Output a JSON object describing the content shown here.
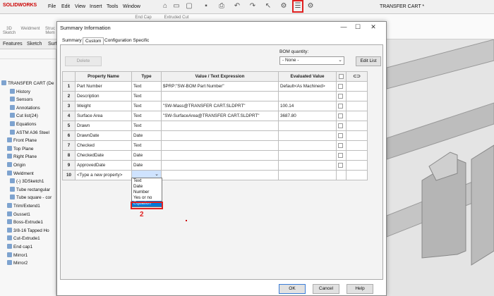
{
  "app": {
    "logo": "SOLIDWORKS",
    "menus": [
      "File",
      "Edit",
      "View",
      "Insert",
      "Tools",
      "Window"
    ],
    "window_title": "TRANSFER CART *"
  },
  "annotations": {
    "marker_1": "1",
    "marker_2": "2"
  },
  "cmdbar": {
    "items": [
      "3D Sketch",
      "Weldment",
      "Struc Mem",
      "End Cap",
      "Extruded Cut"
    ]
  },
  "left_tabs": [
    "Features",
    "Sketch",
    "Surf"
  ],
  "tree": {
    "items": [
      "TRANSFER CART (De",
      "History",
      "Sensors",
      "Annotations",
      "Cut list(24)",
      "Equations",
      "ASTM A36 Steel",
      "Front Plane",
      "Top Plane",
      "Right Plane",
      "Origin",
      "Weldment",
      "(-) 3DSketch1",
      "Tube rectangular",
      "Tube square - cor",
      "Trim/Extend1",
      "Gusset1",
      "Boss-Extrude1",
      "3/8-16 Tapped Ho",
      "Cut-Extrude1",
      "End cap1",
      "Mirror1",
      "Mirror2"
    ]
  },
  "dialog": {
    "title": "Summary Information",
    "tabs": [
      "Summary",
      "Custom",
      "Configuration Specific"
    ],
    "delete_label": "Delete",
    "bom_label": "BOM quantity:",
    "bom_value": "- None -",
    "edit_list_label": "Edit List",
    "ok_label": "OK",
    "cancel_label": "Cancel",
    "help_label": "Help",
    "columns": [
      "Property Name",
      "Type",
      "Value / Text Expression",
      "Evaluated Value"
    ],
    "rows": [
      {
        "num": "1",
        "name": "Part Number",
        "type": "Text",
        "value": "$PRP:\"SW-BOM Part Number\"",
        "evaluated": "Default<As Machined>"
      },
      {
        "num": "2",
        "name": "Description",
        "type": "Text",
        "value": "",
        "evaluated": ""
      },
      {
        "num": "3",
        "name": "Weight",
        "type": "Text",
        "value": "\"SW-Mass@TRANSFER CART.SLDPRT\"",
        "evaluated": "100.14"
      },
      {
        "num": "4",
        "name": "Surface Area",
        "type": "Text",
        "value": "\"SW-SurfaceArea@TRANSFER CART.SLDPRT\"",
        "evaluated": "3687.80"
      },
      {
        "num": "5",
        "name": "Drawn",
        "type": "Text",
        "value": "",
        "evaluated": ""
      },
      {
        "num": "6",
        "name": "DrawnDate",
        "type": "Date",
        "value": "",
        "evaluated": ""
      },
      {
        "num": "7",
        "name": "Checked",
        "type": "Text",
        "value": "",
        "evaluated": ""
      },
      {
        "num": "8",
        "name": "CheckedDate",
        "type": "Date",
        "value": "",
        "evaluated": ""
      },
      {
        "num": "9",
        "name": "ApprovedDate",
        "type": "Date",
        "value": "",
        "evaluated": ""
      },
      {
        "num": "10",
        "name": "<Type a new property>",
        "type": "",
        "value": "",
        "evaluated": ""
      }
    ],
    "type_options": [
      "Text",
      "Date",
      "Number",
      "Yes or no",
      "Equation"
    ],
    "type_selected": "Equation"
  }
}
